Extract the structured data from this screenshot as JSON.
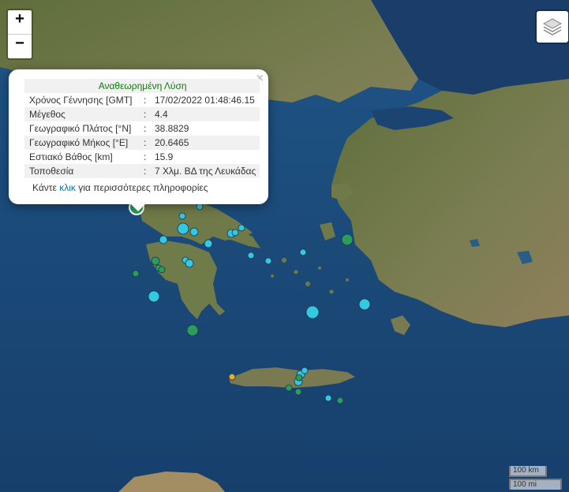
{
  "zoom": {
    "in_label": "+",
    "out_label": "−"
  },
  "layers_button": {
    "icon": "layers-icon"
  },
  "popup": {
    "close_label": "×",
    "title": "Αναθεωρημένη Λύση",
    "rows": [
      {
        "label": "Χρόνος Γέννησης [GMT]",
        "sep": ":",
        "value": "17/02/2022 01:48:46.15"
      },
      {
        "label": "Μέγεθος",
        "sep": ":",
        "value": "4.4"
      },
      {
        "label": "Γεωγραφικό Πλάτος [°N]",
        "sep": ":",
        "value": "38.8829"
      },
      {
        "label": "Γεωγραφικό Μήκος [°E]",
        "sep": ":",
        "value": "20.6465"
      },
      {
        "label": "Εστιακό Βάθος [km]",
        "sep": ":",
        "value": "15.9"
      },
      {
        "label": "Τοποθεσία",
        "sep": ":",
        "value": "7 Χλμ. ΒΔ της Λευκάδας"
      }
    ],
    "more_prefix": "Κάντε ",
    "more_link": "κλικ",
    "more_suffix": " για περισσότερες πληροφορίες"
  },
  "scale": {
    "metric": "100 km",
    "imperial": "100 mi"
  },
  "colors": {
    "sea": "#1d4a7a",
    "land": "#6f7a48",
    "marker_cyan": "#33c9e0",
    "marker_green": "#2a9d5a",
    "marker_yellow": "#e0b030",
    "link": "#0078a8",
    "popup_title": "#0a7d0a"
  }
}
